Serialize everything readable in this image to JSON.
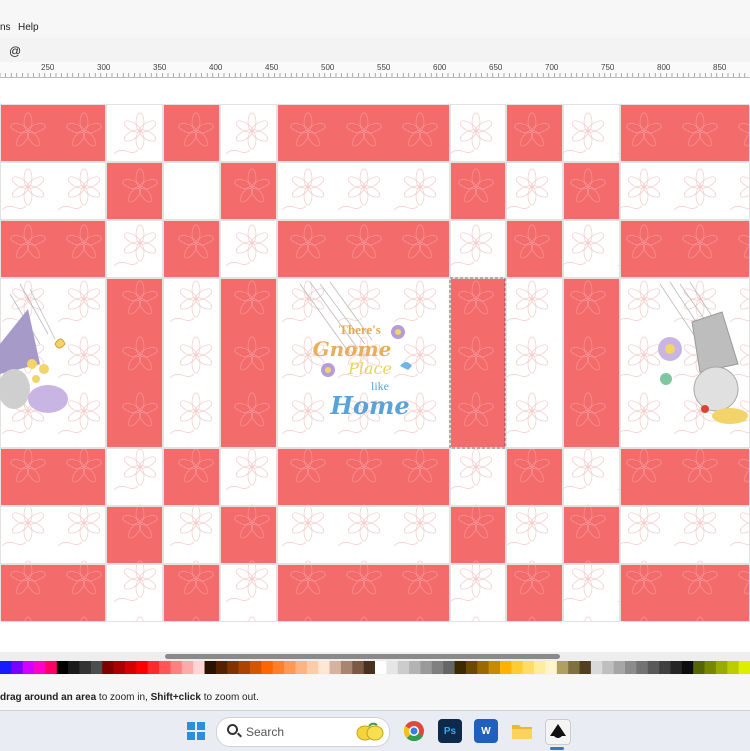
{
  "menubar": {
    "items": [
      {
        "label": "ns"
      },
      {
        "label": "Help"
      }
    ]
  },
  "toolbar": {
    "zoom_icon": "@"
  },
  "ruler": {
    "labels": [
      "250",
      "300",
      "350",
      "400",
      "450",
      "500",
      "550",
      "600",
      "650",
      "700",
      "750",
      "800",
      "850"
    ]
  },
  "canvas": {
    "block_color": "#f36b6b",
    "light_color": "#ffffff",
    "seam_color": "#e2e2e2",
    "center_text": {
      "line1": "There's",
      "line2": "Gnome",
      "line3": "Place",
      "line4": "like",
      "line5": "Home"
    }
  },
  "palette": {
    "colors": [
      "#1a1aff",
      "#7700ff",
      "#d400ff",
      "#ff00c8",
      "#ff0066",
      "#000000",
      "#1a1a1a",
      "#333333",
      "#4d4d4d",
      "#800000",
      "#aa0000",
      "#d40000",
      "#ff0000",
      "#ff2a2a",
      "#ff5555",
      "#ff8080",
      "#ffaaaa",
      "#ffd5d5",
      "#2b1100",
      "#552200",
      "#803300",
      "#aa4400",
      "#d45500",
      "#ff6600",
      "#ff7f2a",
      "#ff9955",
      "#ffb380",
      "#ffccaa",
      "#ffe6d5",
      "#d5b3a0",
      "#a88570",
      "#7a5a45",
      "#4a3020",
      "#ffffff",
      "#e6e6e6",
      "#cccccc",
      "#b3b3b3",
      "#999999",
      "#808080",
      "#666666",
      "#3d2b00",
      "#6b4a00",
      "#9a6a00",
      "#c88a00",
      "#ffb300",
      "#ffcc33",
      "#ffdd66",
      "#ffee99",
      "#fff5cc",
      "#b0a060",
      "#807040",
      "#504020",
      "#d9d9d9",
      "#bfbfbf",
      "#a6a6a6",
      "#8c8c8c",
      "#737373",
      "#595959",
      "#404040",
      "#262626",
      "#0d0d0d",
      "#556600",
      "#778800",
      "#99aa00",
      "#bbcc00",
      "#ddee00"
    ]
  },
  "statusbar": {
    "message_bold1": "drag around an area",
    "message_mid": " to zoom in, ",
    "message_bold2": "Shift+click",
    "message_end": " to zoom out."
  },
  "taskbar": {
    "search_placeholder": "Search",
    "apps": [
      {
        "name": "start-button-icon"
      },
      {
        "name": "search-box"
      },
      {
        "name": "lemons-widget-icon"
      },
      {
        "name": "chrome-icon"
      },
      {
        "name": "photoshop-icon",
        "label": "Ps"
      },
      {
        "name": "word-icon",
        "label": "W"
      },
      {
        "name": "file-explorer-icon"
      },
      {
        "name": "inkscape-icon"
      }
    ]
  }
}
